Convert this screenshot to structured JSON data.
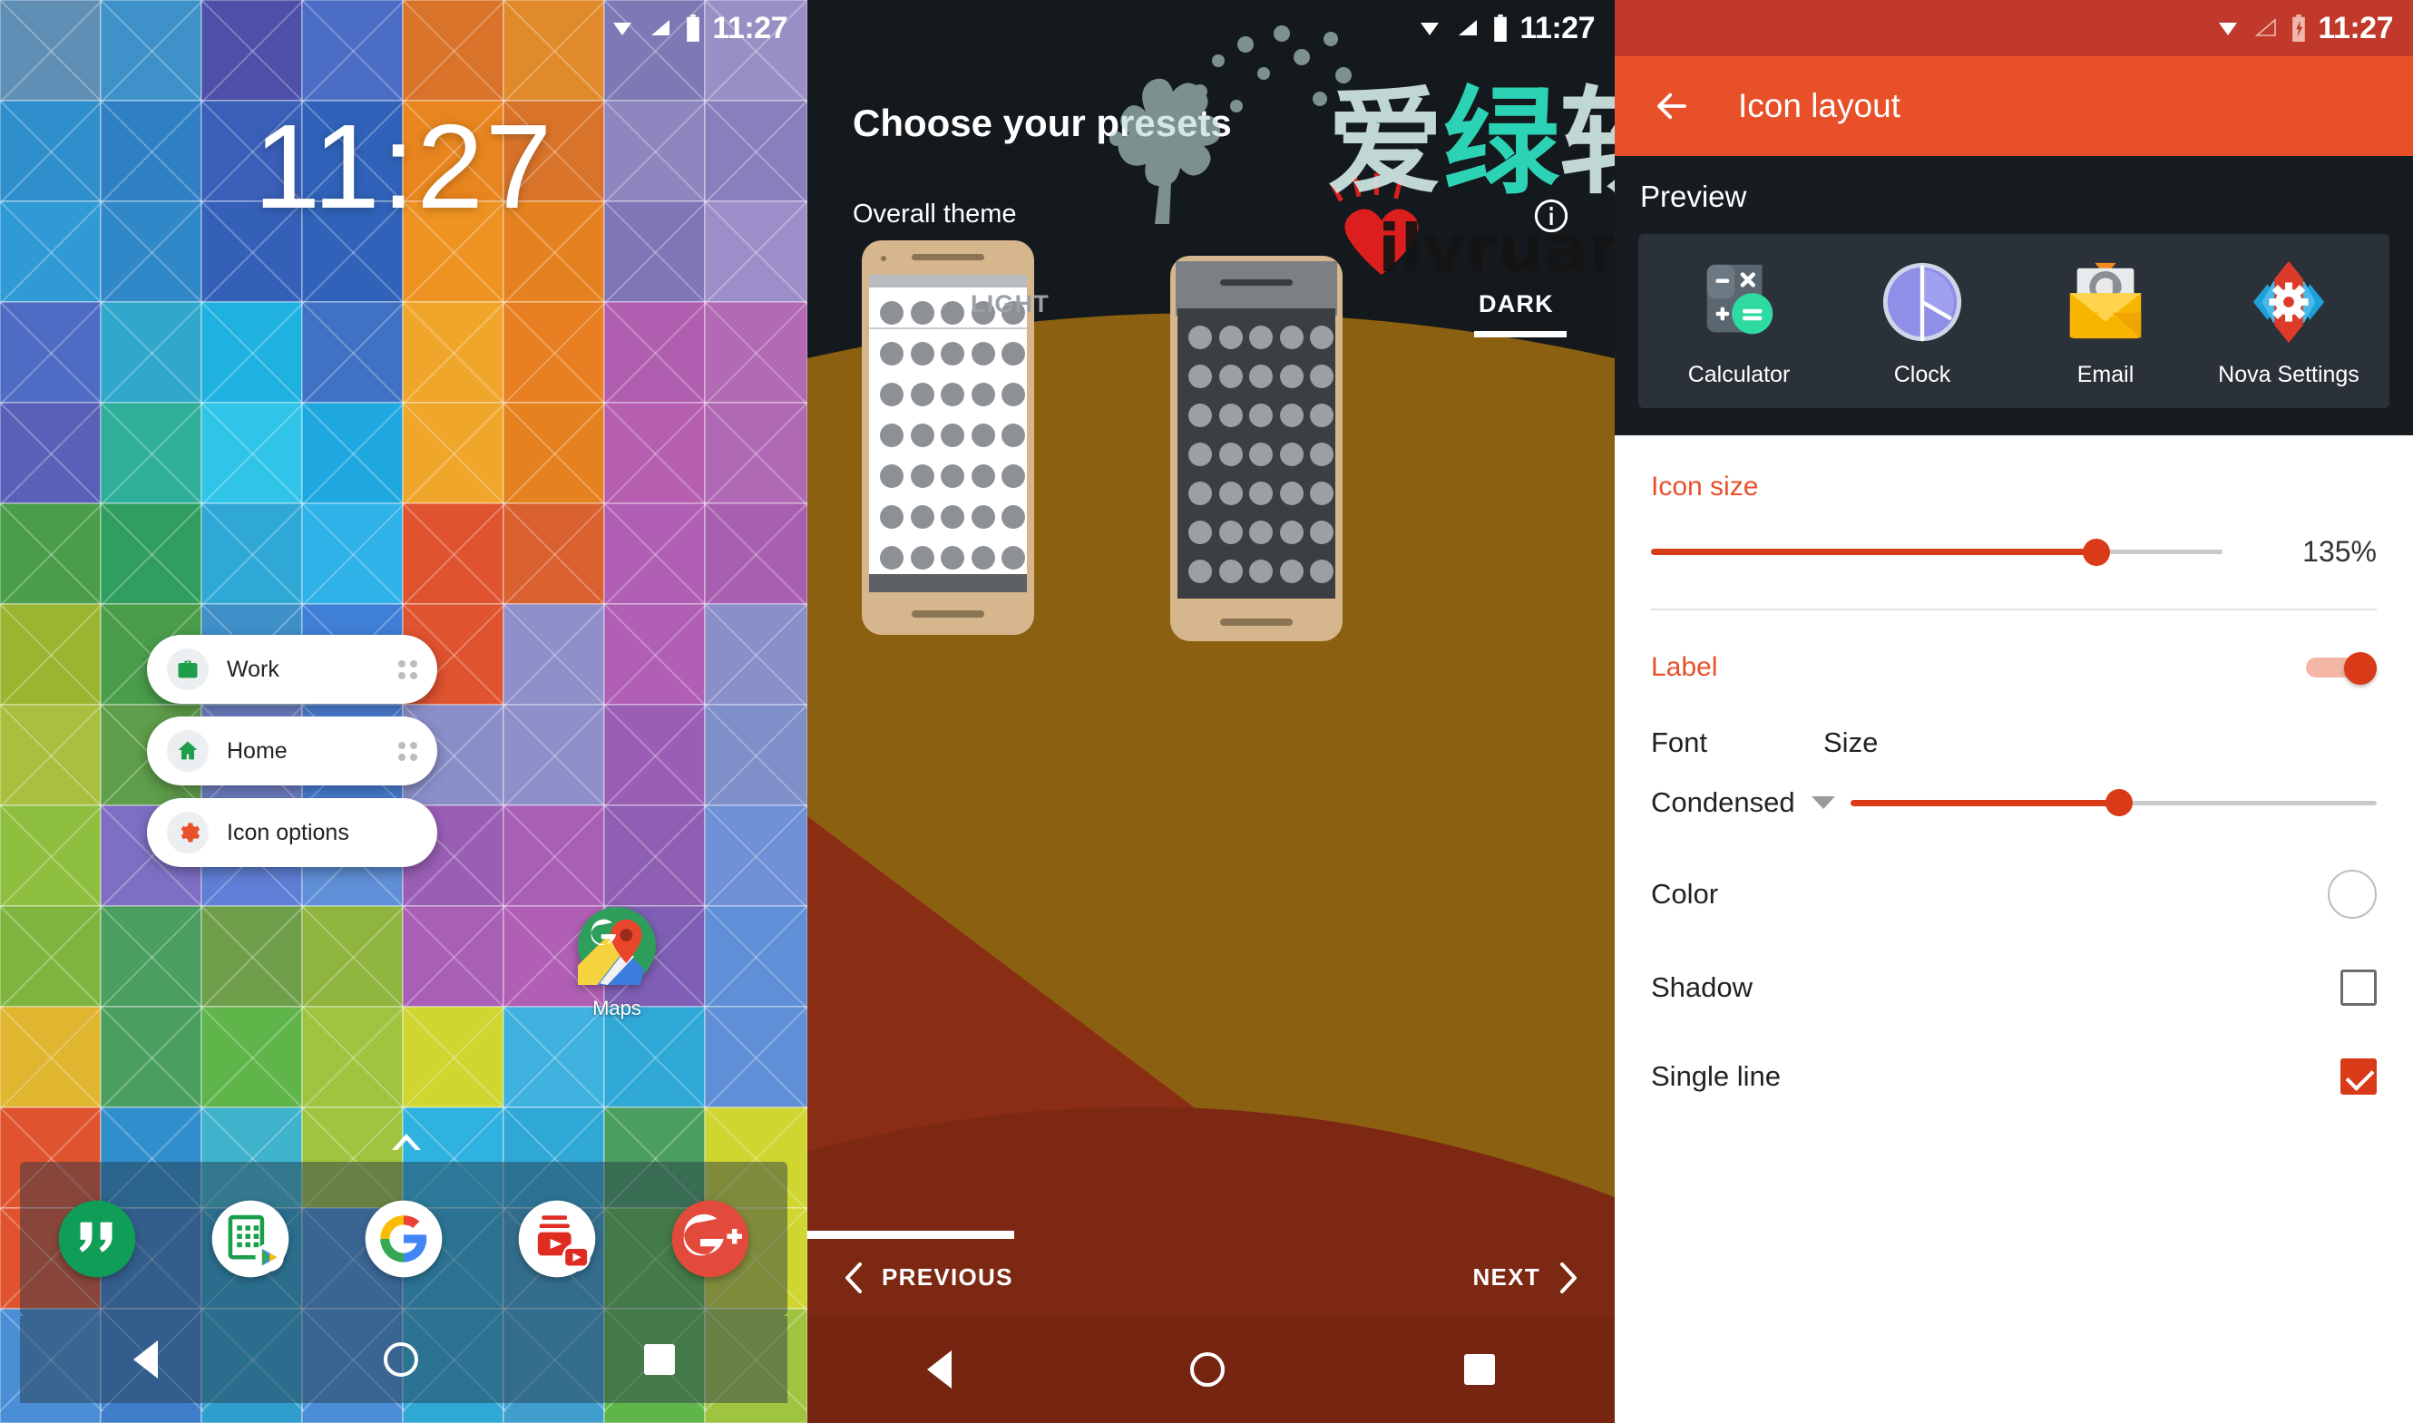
{
  "statusbar": {
    "time": "11:27",
    "icons": [
      "wifi-icon",
      "signal-icon",
      "battery-icon"
    ]
  },
  "home_screen": {
    "clock_widget": "11:27",
    "shortcut_menu": [
      {
        "label": "Work",
        "icon": "briefcase-icon",
        "icon_color": "#1e9e4a",
        "has_drag_handle": true
      },
      {
        "label": "Home",
        "icon": "house-icon",
        "icon_color": "#1e9e4a",
        "has_drag_handle": true
      },
      {
        "label": "Icon options",
        "icon": "gear-icon",
        "icon_color": "#e8502a",
        "has_drag_handle": false
      }
    ],
    "app": {
      "label": "Maps",
      "icon": "google-maps-icon"
    },
    "page_indicator": "chevron-up-icon",
    "dock": [
      {
        "name": "Hangouts",
        "icon": "hangouts-icon"
      },
      {
        "name": "Sheets",
        "icon": "sheets-icon"
      },
      {
        "name": "Google",
        "icon": "google-icon"
      },
      {
        "name": "YouTube",
        "icon": "youtube-icon"
      },
      {
        "name": "Google Plus",
        "icon": "google-plus-icon"
      }
    ],
    "navbar": [
      "back-icon",
      "home-icon",
      "recents-icon"
    ]
  },
  "presets_screen": {
    "title": "Choose your presets",
    "section_label": "Overall theme",
    "info_icon": "info-icon",
    "tabs": [
      {
        "label": "LIGHT",
        "selected": false
      },
      {
        "label": "DARK",
        "selected": true
      }
    ],
    "previous_label": "PREVIOUS",
    "next_label": "NEXT",
    "previous_icon": "chevron-left-icon",
    "next_icon": "chevron-right-icon",
    "navbar": [
      "back-icon",
      "home-icon",
      "recents-icon"
    ]
  },
  "icon_layout_screen": {
    "back_icon": "arrow-back-icon",
    "app_title": "Icon layout",
    "preview_title": "Preview",
    "preview_apps": [
      {
        "label": "Calculator",
        "icon": "calculator-icon"
      },
      {
        "label": "Clock",
        "icon": "clock-icon"
      },
      {
        "label": "Email",
        "icon": "email-icon"
      },
      {
        "label": "Nova Settings",
        "icon": "nova-settings-icon"
      }
    ],
    "icon_size": {
      "title": "Icon size",
      "value": "135%",
      "fill_percent": 78
    },
    "label_section": {
      "title": "Label",
      "toggle_on": true,
      "font_label": "Font",
      "font_value": "Condensed",
      "size_label": "Size",
      "size_fill_percent": 51
    },
    "color_row": {
      "label": "Color",
      "swatch_color": "#ffffff"
    },
    "shadow_row": {
      "label": "Shadow",
      "checked": false
    },
    "single_line_row": {
      "label": "Single line",
      "checked": true
    }
  },
  "watermark": {
    "text_cn": "爱绿软",
    "text_url": "ilvruan.com",
    "color_cn": "#2ee0c0",
    "color_url": "#111111"
  },
  "colors": {
    "accent_red": "#e8502a",
    "slider_red": "#d93a17",
    "statusbar_red": "#c0392b",
    "dark_bg": "#14191d",
    "preview_bg": "#171c21",
    "preview_card": "#2b3138"
  }
}
